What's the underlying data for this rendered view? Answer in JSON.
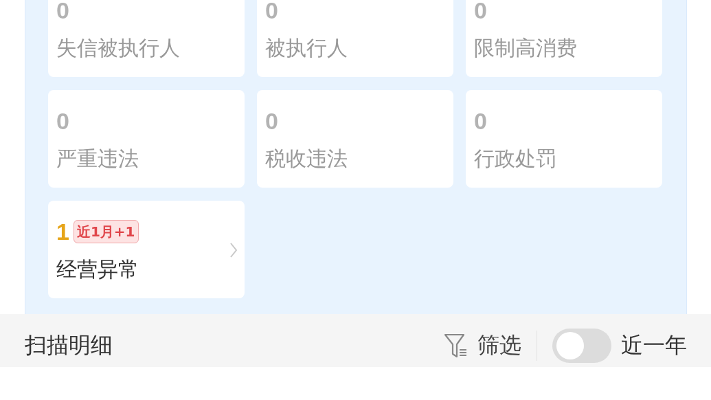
{
  "risk_cards": [
    {
      "count": "0",
      "label": "失信被执行人",
      "highlighted": false
    },
    {
      "count": "0",
      "label": "被执行人",
      "highlighted": false
    },
    {
      "count": "0",
      "label": "限制高消费",
      "highlighted": false
    },
    {
      "count": "0",
      "label": "严重违法",
      "highlighted": false
    },
    {
      "count": "0",
      "label": "税收违法",
      "highlighted": false
    },
    {
      "count": "0",
      "label": "行政处罚",
      "highlighted": false
    },
    {
      "count": "1",
      "label": "经营异常",
      "highlighted": true,
      "badge": "近1月+1"
    }
  ],
  "scan_details": {
    "title": "扫描明细",
    "filter": "筛选",
    "toggle": {
      "label": "近一年",
      "on": false
    }
  }
}
